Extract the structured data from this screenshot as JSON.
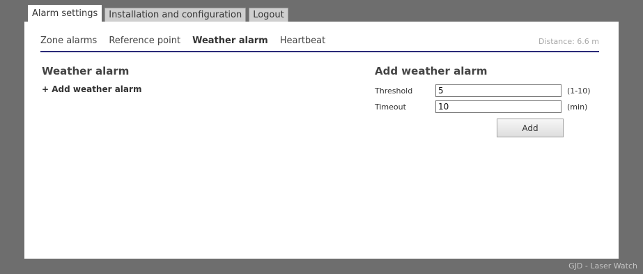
{
  "top_tabs": [
    {
      "label": "Alarm settings",
      "active": true
    },
    {
      "label": "Installation and configuration",
      "active": false
    },
    {
      "label": "Logout",
      "active": false
    }
  ],
  "subnav": {
    "items": [
      {
        "label": "Zone alarms",
        "active": false
      },
      {
        "label": "Reference point",
        "active": false
      },
      {
        "label": "Weather alarm",
        "active": true
      },
      {
        "label": "Heartbeat",
        "active": false
      }
    ],
    "distance": "Distance: 6.6 m"
  },
  "left": {
    "title": "Weather alarm",
    "add_link": "+ Add weather alarm"
  },
  "form": {
    "title": "Add weather alarm",
    "threshold": {
      "label": "Threshold",
      "value": "5",
      "unit": "(1-10)"
    },
    "timeout": {
      "label": "Timeout",
      "value": "10",
      "unit": "(min)"
    },
    "add_button": "Add"
  },
  "footer": "GJD - Laser Watch",
  "colors": {
    "background": "#6e6e6e",
    "nav_underline": "#2a2a78",
    "panel": "#ffffff"
  }
}
